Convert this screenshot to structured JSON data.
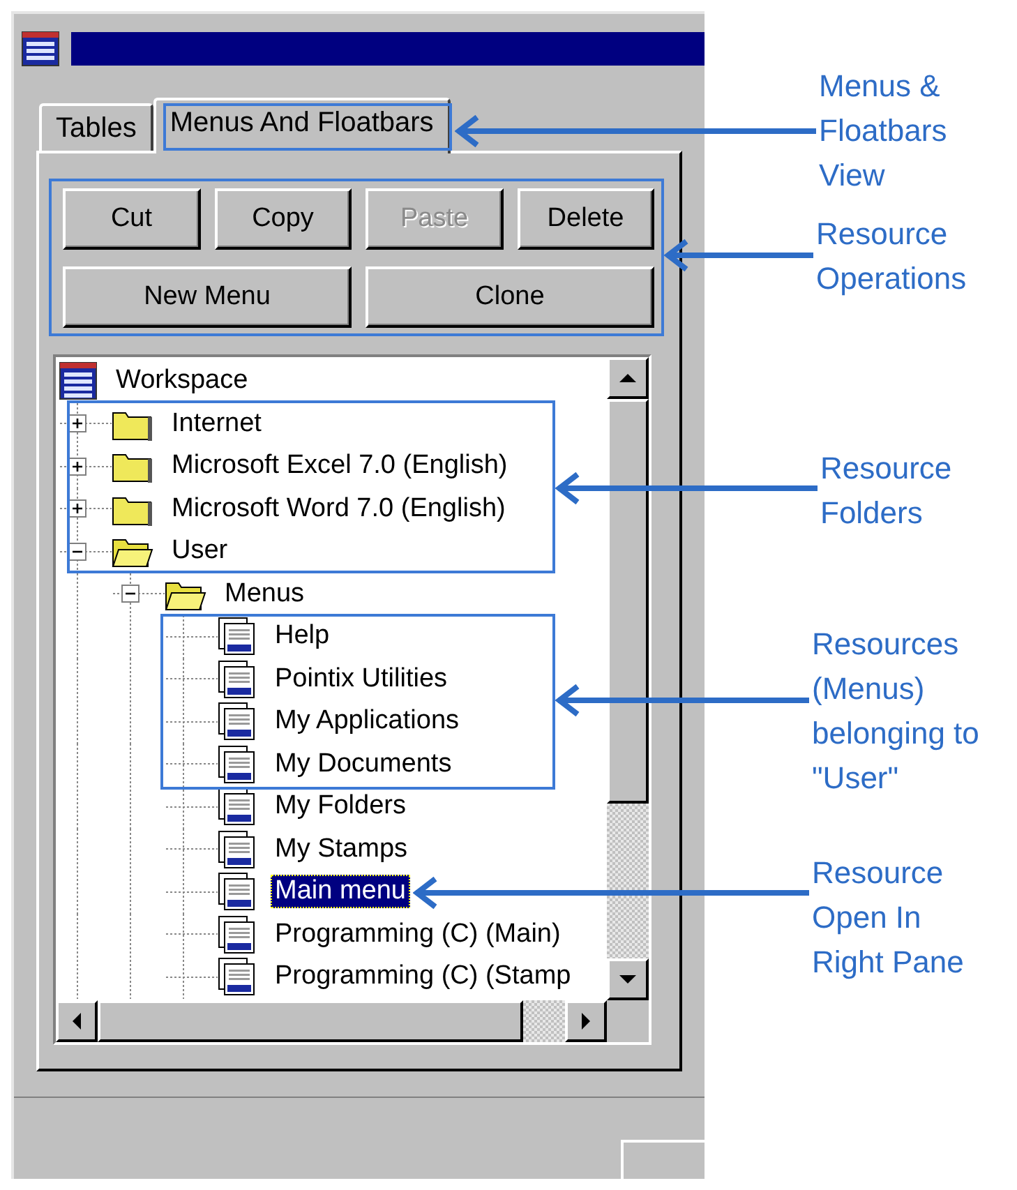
{
  "window": {
    "tabs": [
      {
        "label": "Tables",
        "selected": false
      },
      {
        "label": "Menus And Floatbars",
        "selected": true
      }
    ],
    "button_rows": [
      [
        {
          "label": "Cut",
          "disabled": false
        },
        {
          "label": "Copy",
          "disabled": false
        },
        {
          "label": "Paste",
          "disabled": true
        },
        {
          "label": "Delete",
          "disabled": false
        }
      ],
      [
        {
          "label": "New Menu",
          "disabled": false
        },
        {
          "label": "Clone",
          "disabled": false
        }
      ]
    ],
    "tree": {
      "items": [
        {
          "kind": "workspace",
          "label": "Workspace",
          "selected": false,
          "children": [
            {
              "kind": "folder",
              "label": "Internet",
              "selected": false,
              "expanded": false
            },
            {
              "kind": "folder",
              "label": "Microsoft Excel 7.0 (English)",
              "selected": false,
              "expanded": false
            },
            {
              "kind": "folder",
              "label": "Microsoft Word 7.0 (English)",
              "selected": false,
              "expanded": false
            },
            {
              "kind": "folder",
              "label": "User",
              "selected": false,
              "expanded": true,
              "children": [
                {
                  "kind": "folder",
                  "label": "Menus",
                  "selected": false,
                  "expanded": true,
                  "children": [
                    {
                      "kind": "menu",
                      "label": "Help",
                      "selected": false
                    },
                    {
                      "kind": "menu",
                      "label": "Pointix Utilities",
                      "selected": false
                    },
                    {
                      "kind": "menu",
                      "label": "My Applications",
                      "selected": false
                    },
                    {
                      "kind": "menu",
                      "label": "My Documents",
                      "selected": false
                    },
                    {
                      "kind": "menu",
                      "label": "My Folders",
                      "selected": false
                    },
                    {
                      "kind": "menu",
                      "label": "My Stamps",
                      "selected": false
                    },
                    {
                      "kind": "menu",
                      "label": "Main menu",
                      "selected": true
                    },
                    {
                      "kind": "menu",
                      "label": "Programming (C) (Main)",
                      "selected": false
                    },
                    {
                      "kind": "menu",
                      "label": "Programming (C) (Stamp",
                      "selected": false
                    }
                  ]
                }
              ]
            }
          ]
        }
      ]
    }
  },
  "annotations": [
    {
      "text": "Menus &\nFloatbars\nView"
    },
    {
      "text": "Resource\nOperations"
    },
    {
      "text": "Resource\nFolders"
    },
    {
      "text": "Resources\n(Menus)\nbelonging to\n\"User\""
    },
    {
      "text": "Resource\nOpen In\nRight Pane"
    }
  ]
}
